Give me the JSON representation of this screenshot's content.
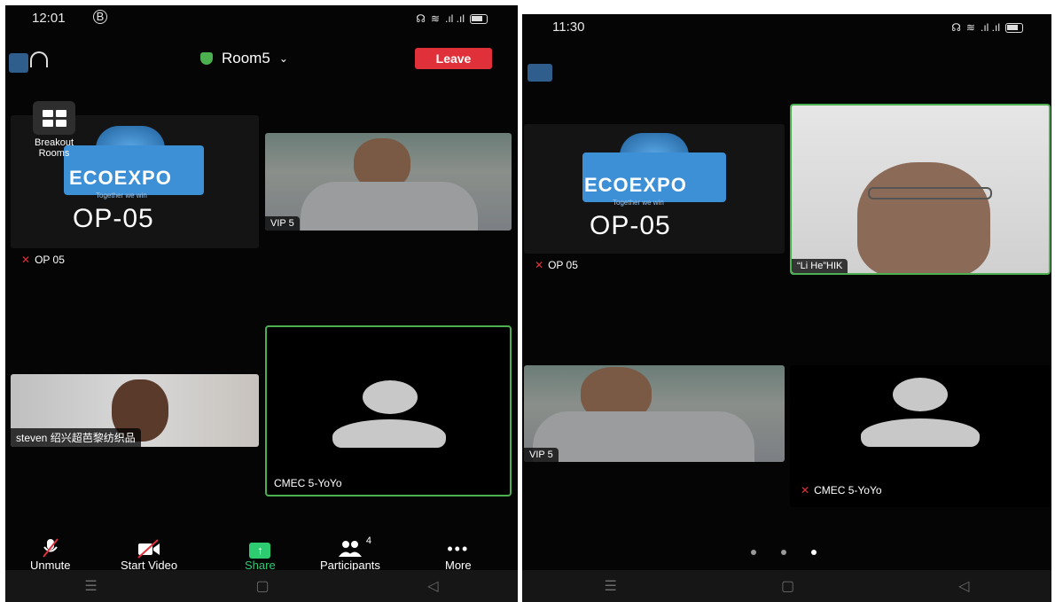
{
  "phone1": {
    "time": "12:01",
    "room": "Room5",
    "leave": "Leave",
    "breakout": "Breakout Rooms",
    "tiles": {
      "op": {
        "title_main": "ECOEXPO",
        "slogan": "Together we win",
        "code": "OP-05",
        "name": "OP 05"
      },
      "vip": {
        "name": "VIP 5"
      },
      "steven": {
        "name": "steven 绍兴超芭黎纺织品"
      },
      "cmec": {
        "name": "CMEC 5-YoYo"
      }
    },
    "toolbar": {
      "unmute": "Unmute",
      "start_video": "Start Video",
      "share": "Share",
      "participants": "Participants",
      "participant_count": "4",
      "more": "More"
    }
  },
  "phone2": {
    "time": "11:30",
    "tiles": {
      "op": {
        "title_main": "ECOEXPO",
        "slogan": "Together we win",
        "code": "OP-05",
        "name": "OP 05"
      },
      "li": {
        "name": "“Li He”HIK"
      },
      "vip": {
        "name": "VIP 5"
      },
      "cmec": {
        "name": "CMEC 5-YoYo"
      }
    },
    "page_dots": 3,
    "active_dot": 3
  },
  "colors": {
    "active_border": "#4caf50",
    "leave": "#e0303a",
    "share": "#2ecc71",
    "shield": "#4caf50"
  }
}
